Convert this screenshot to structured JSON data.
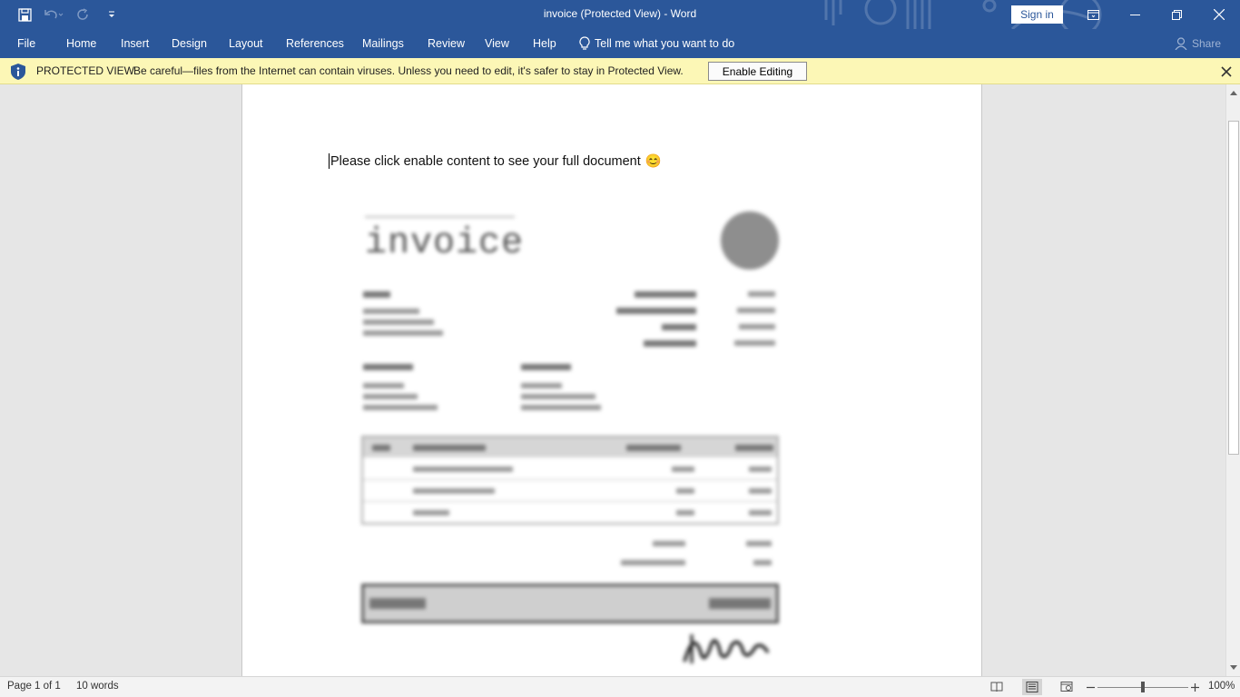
{
  "titlebar": {
    "title": "invoice (Protected View)  -  Word",
    "signin_label": "Sign in",
    "colors": {
      "brand": "#2b579a"
    }
  },
  "ribbon": {
    "tabs": [
      "File",
      "Home",
      "Insert",
      "Design",
      "Layout",
      "References",
      "Mailings",
      "Review",
      "View",
      "Help"
    ],
    "tell_me": "Tell me what you want to do",
    "share": "Share"
  },
  "protected_view": {
    "title": "PROTECTED VIEW",
    "message": "Be careful—files from the Internet can contain viruses. Unless you need to edit, it's safer to stay in Protected View.",
    "enable_button": "Enable Editing",
    "colors": {
      "background": "#fcf7b6"
    }
  },
  "document": {
    "line": "Please click enable content to see your full document",
    "emoji": "😊",
    "image_title": "invoice"
  },
  "statusbar": {
    "page": "Page 1 of 1",
    "words": "10 words",
    "zoom": "100%"
  }
}
